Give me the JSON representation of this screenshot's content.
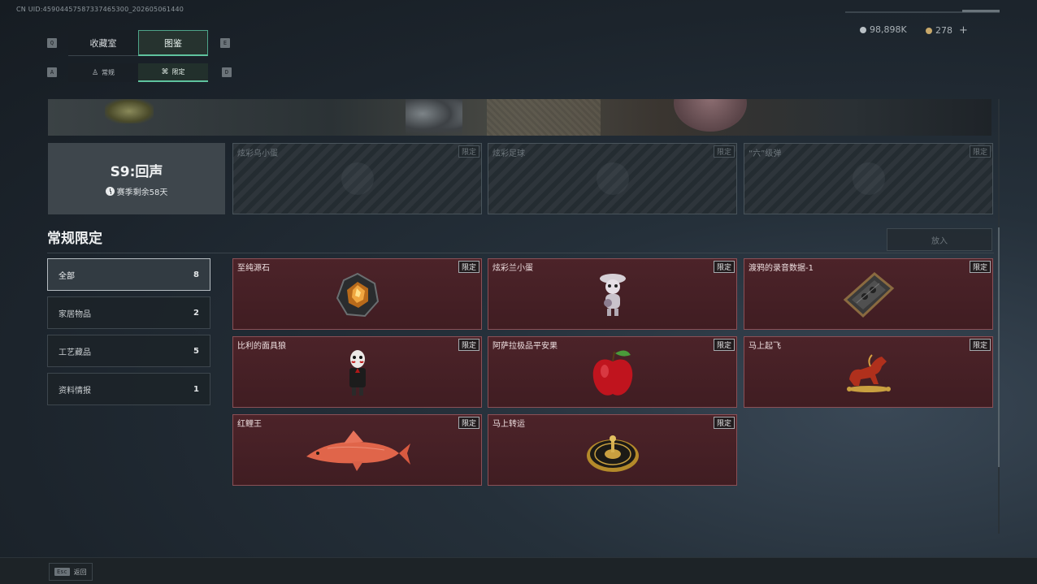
{
  "uid": "CN UID:459044575873374653​00_202605061440",
  "header": {
    "tabs": [
      {
        "label": "收藏室",
        "key": "Q",
        "active": false
      },
      {
        "label": "图鉴",
        "key": "E",
        "active": true
      }
    ],
    "subtabs": [
      {
        "label": "常规",
        "key": "A",
        "active": false
      },
      {
        "label": "限定",
        "key": "D",
        "active": true
      }
    ],
    "currency": [
      {
        "value": "98,898K",
        "color": "#b9c0c5"
      },
      {
        "value": "278",
        "plus": "+",
        "color": "#c8a86a"
      }
    ]
  },
  "season": {
    "title": "S9:回声",
    "remaining": "赛季剩余58天"
  },
  "locked_items": [
    {
      "name": "炫彩乌小蛋",
      "tag": "限定"
    },
    {
      "name": "炫彩足球",
      "tag": "限定"
    },
    {
      "name": "“六”级弹",
      "tag": "限定"
    }
  ],
  "section": {
    "title": "常规限定",
    "put_button": "放入"
  },
  "filters": [
    {
      "label": "全部",
      "count": "8",
      "active": true
    },
    {
      "label": "家居物品",
      "count": "2",
      "active": false
    },
    {
      "label": "工艺藏品",
      "count": "5",
      "active": false
    },
    {
      "label": "资料情报",
      "count": "1",
      "active": false
    }
  ],
  "items": [
    {
      "name": "至纯源石",
      "tag": "限定",
      "icon": "gem-icon"
    },
    {
      "name": "炫彩兰小蛋",
      "tag": "限定",
      "icon": "figurine-icon"
    },
    {
      "name": "渡鸦的录音数据-1",
      "tag": "限定",
      "icon": "cassette-icon"
    },
    {
      "name": "比利的面具狼",
      "tag": "限定",
      "icon": "puppet-icon"
    },
    {
      "name": "阿萨拉极品平安果",
      "tag": "限定",
      "icon": "apple-icon"
    },
    {
      "name": "马上起飞",
      "tag": "限定",
      "icon": "horse-icon"
    },
    {
      "name": "红鲤王",
      "tag": "限定",
      "icon": "carp-icon"
    },
    {
      "name": "马上转运",
      "tag": "限定",
      "icon": "compass-icon"
    }
  ],
  "footer": {
    "esc_key": "Esc",
    "back_label": "返回"
  }
}
